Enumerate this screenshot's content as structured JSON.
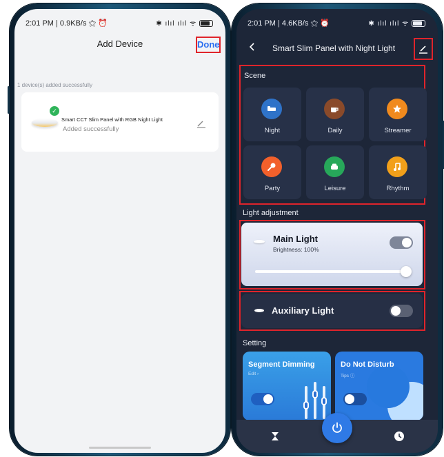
{
  "left": {
    "status": {
      "time": "2:01 PM | 0.9KB/s ⚝ ⏰",
      "icons": "✱ ılıl ılıl ᯤ"
    },
    "header": {
      "title": "Add Device",
      "done_label": "Done"
    },
    "success_note": "1 device(s) added successfully",
    "device": {
      "name": "Smart CCT Slim Panel with RGB Night Light",
      "status": "Added successfully",
      "icon": "ceiling-lamp-icon"
    }
  },
  "right": {
    "status": {
      "time": "2:01 PM | 4.6KB/s ⚝ ⏰",
      "icons": "✱ ılıl ılıl ᯤ"
    },
    "header": {
      "title": "Smart Slim Panel with Night Light"
    },
    "scene": {
      "label": "Scene",
      "items": [
        {
          "label": "Night",
          "icon": "bed-icon",
          "color": "#2f73c9"
        },
        {
          "label": "Daily",
          "icon": "coffee-icon",
          "color": "#8a4a2a"
        },
        {
          "label": "Streamer",
          "icon": "star-icon",
          "color": "#f08a1e"
        },
        {
          "label": "Party",
          "icon": "mic-icon",
          "color": "#f2602b"
        },
        {
          "label": "Leisure",
          "icon": "car-icon",
          "color": "#27a85a"
        },
        {
          "label": "Rhythm",
          "icon": "music-icon",
          "color": "#f2a01a"
        }
      ]
    },
    "light_adjustment": {
      "label": "Light adjustment",
      "main": {
        "title": "Main Light",
        "brightness": "Brightness: 100%",
        "brightness_value": 1.0,
        "on": true
      },
      "aux": {
        "title": "Auxiliary Light",
        "on": false
      }
    },
    "setting": {
      "label": "Setting",
      "segment": {
        "title": "Segment Dimming",
        "sub": "Edit ›",
        "on": true,
        "color": "#3aa0e8"
      },
      "dnd": {
        "title": "Do Not Disturb",
        "sub": "Tips ⓘ",
        "on": false,
        "color": "#2a7ae0"
      }
    },
    "bottom_bar": [
      "hourglass-icon",
      "power-icon",
      "clock-icon"
    ]
  },
  "colors": {
    "accent": "#2a6ef0",
    "highlight": "#e0242b",
    "success": "#2fb45a"
  }
}
